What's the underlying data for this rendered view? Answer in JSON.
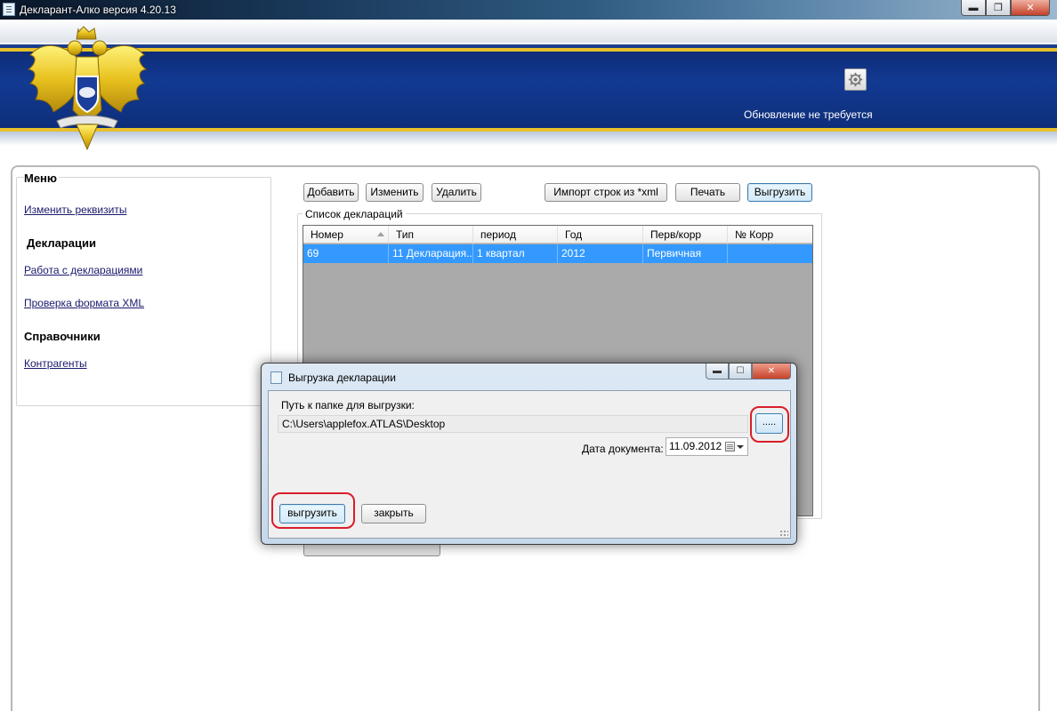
{
  "window": {
    "title": "Декларант-Алко версия 4.20.13",
    "minimize_glyph": "▬",
    "maximize_glyph": "❐",
    "close_glyph": "✕"
  },
  "header": {
    "update_status": "Обновление не требуется",
    "settings_icon": "gear-icon"
  },
  "menu": {
    "title": "Меню",
    "change_requisites": "Изменить реквизиты",
    "section_declarations": "Декларации",
    "work_with_declarations": "Работа с декларациями",
    "check_xml_format": "Проверка формата XML",
    "section_references": "Справочники",
    "contractors": "Контрагенты"
  },
  "toolbar": {
    "add": "Добавить",
    "edit": "Изменить",
    "delete": "Удалить",
    "import_rows": "Импорт строк из *xml",
    "print": "Печать",
    "export": "Выгрузить"
  },
  "declarations_list": {
    "label": "Список деклараций",
    "columns": [
      "Номер",
      "Тип",
      "период",
      "Год",
      "Перв/корр",
      "№ Корр"
    ],
    "rows": [
      [
        "69",
        "11 Декларация...",
        "1 квартал",
        "2012",
        "Первичная",
        ""
      ]
    ]
  },
  "dialog": {
    "title": "Выгрузка декларации",
    "min_glyph": "▬",
    "max_glyph": "☐",
    "close_glyph": "✕",
    "path_label": "Путь к папке для выгрузки:",
    "path_value": "C:\\Users\\applefox.ATLAS\\Desktop",
    "browse_label": ".....",
    "date_label": "Дата документа:",
    "date_value": "11.09.2012",
    "export_button": "выгрузить",
    "close_button": "закрыть"
  },
  "colors": {
    "banner_blue": "#123a92",
    "banner_gold": "#e7c02b",
    "selection_blue": "#3399ff",
    "highlight_red": "#d81e2a"
  }
}
